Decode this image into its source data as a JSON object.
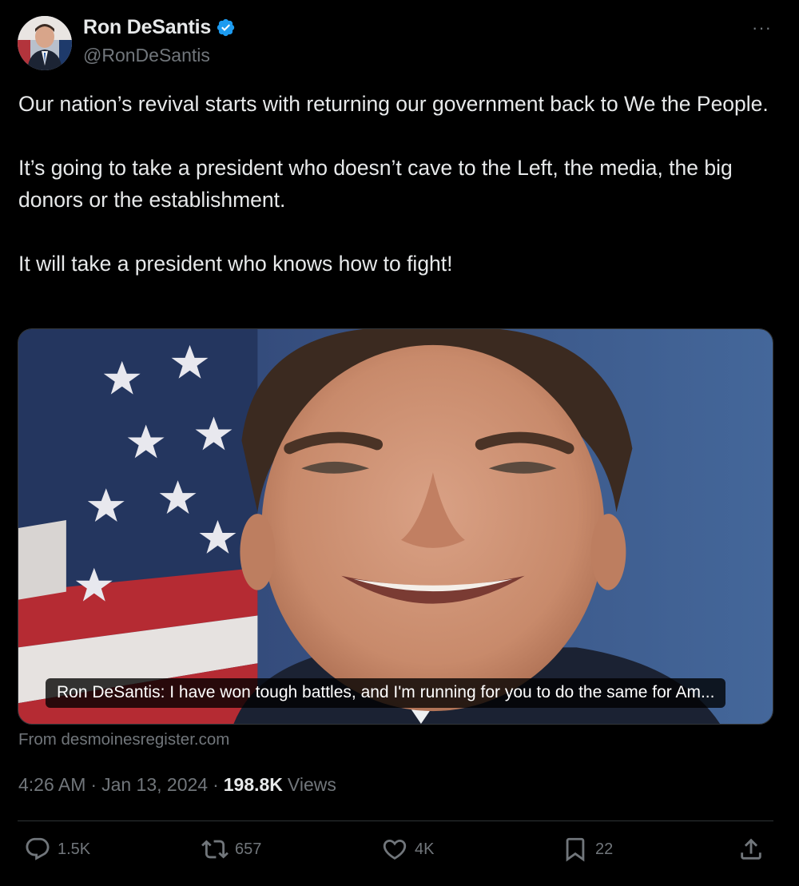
{
  "author": {
    "display_name": "Ron DeSantis",
    "handle": "@RonDeSantis",
    "verified": true,
    "verified_color": "#1d9bf0"
  },
  "more_label": "···",
  "tweet": {
    "paragraphs": [
      "Our nation’s revival starts with returning our government back to We the People.",
      "It’s going to take a president who doesn’t cave to the Left, the media, the big donors or the establishment.",
      "It will take a president who knows how to fight!"
    ]
  },
  "media": {
    "caption": "Ron DeSantis: I have won tough battles, and I'm running for you to do the same for Am...",
    "source": "From desmoinesregister.com"
  },
  "meta": {
    "time": "4:26 AM",
    "separator": "·",
    "date": "Jan 13, 2024",
    "views_count": "198.8K",
    "views_label": "Views"
  },
  "actions": {
    "replies": "1.5K",
    "reposts": "657",
    "likes": "4K",
    "bookmarks": "22"
  },
  "colors": {
    "background": "#000000",
    "text_primary": "#e7e9ea",
    "text_secondary": "#71767b",
    "divider": "#2f3336"
  }
}
